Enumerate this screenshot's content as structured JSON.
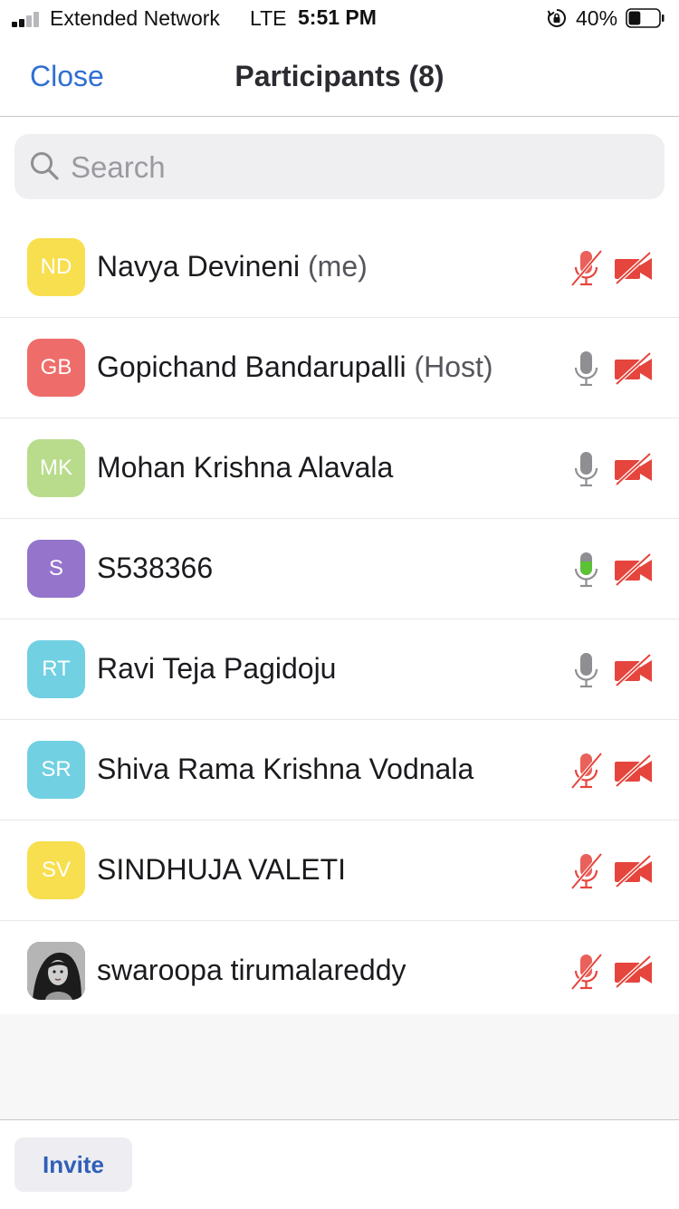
{
  "status_bar": {
    "carrier": "Extended Network",
    "network": "LTE",
    "time": "5:51 PM",
    "battery_percent": "40%",
    "battery_level": 0.4,
    "signal_bars_filled": 2
  },
  "nav": {
    "close_label": "Close",
    "title": "Participants (8)"
  },
  "search": {
    "placeholder": "Search"
  },
  "participants": [
    {
      "initials": "ND",
      "name": "Navya Devineni",
      "tag": "(me)",
      "avatar_color": "#f7df4f",
      "mic": "muted",
      "video": "off"
    },
    {
      "initials": "GB",
      "name": "Gopichand Bandarupalli",
      "tag": "(Host)",
      "avatar_color": "#ee6d6a",
      "mic": "on",
      "video": "off"
    },
    {
      "initials": "MK",
      "name": "Mohan Krishna Alavala",
      "tag": "",
      "avatar_color": "#b9dc8c",
      "mic": "on",
      "video": "off"
    },
    {
      "initials": "S",
      "name": "S538366",
      "tag": "",
      "avatar_color": "#9574cc",
      "mic": "speaking",
      "video": "off"
    },
    {
      "initials": "RT",
      "name": "Ravi Teja Pagidoju",
      "tag": "",
      "avatar_color": "#71d0e2",
      "mic": "on",
      "video": "off"
    },
    {
      "initials": "SR",
      "name": "Shiva Rama Krishna Vodnala",
      "tag": "",
      "avatar_color": "#71d0e2",
      "mic": "muted",
      "video": "off"
    },
    {
      "initials": "SV",
      "name": "SINDHUJA VALETI",
      "tag": "",
      "avatar_color": "#f7df4f",
      "mic": "muted",
      "video": "off"
    },
    {
      "initials": "",
      "name": "swaroopa tirumalareddy",
      "tag": "",
      "avatar_color": "#3a3a3a",
      "avatar_type": "photo",
      "mic": "muted",
      "video": "off"
    }
  ],
  "footer": {
    "invite_label": "Invite"
  },
  "colors": {
    "accent": "#2f6fd3",
    "muted_red": "#e5453d",
    "mic_gray": "#8e8e93",
    "speaking_green": "#5bc236"
  }
}
